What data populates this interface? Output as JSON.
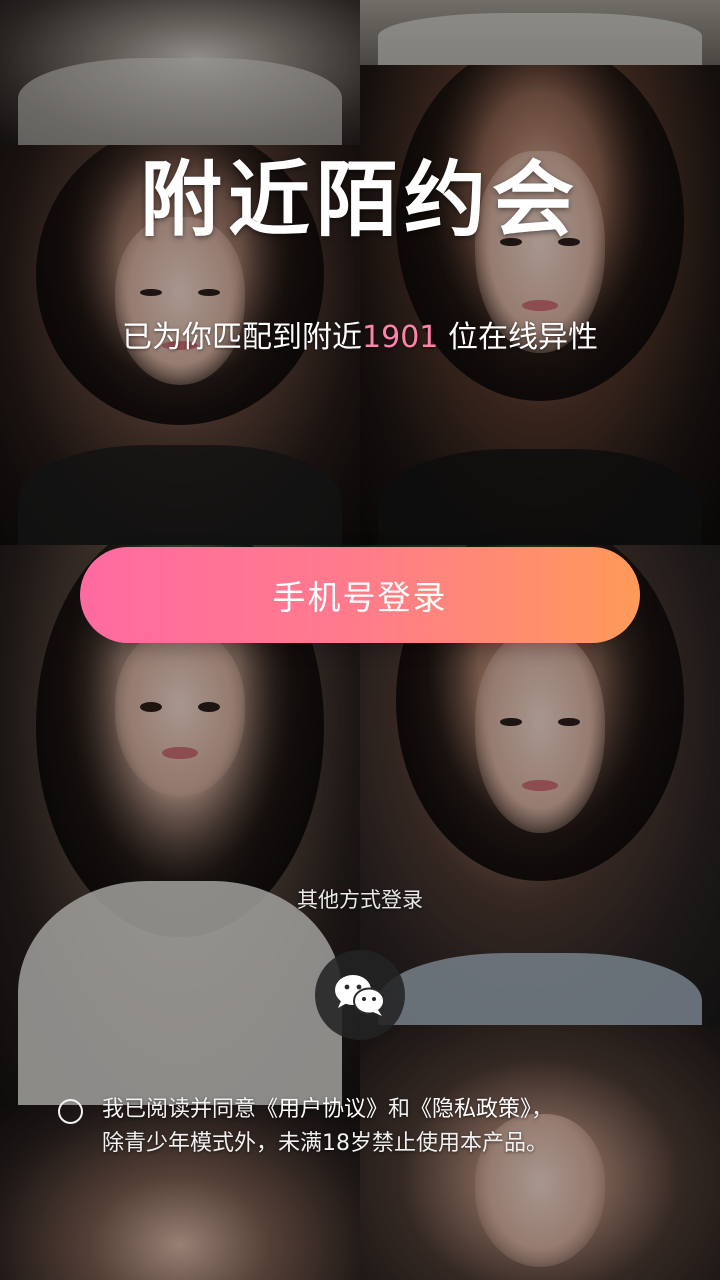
{
  "header": {
    "title": "附近陌约会",
    "subtitle_prefix": "已为你匹配到附近",
    "match_count": "1901",
    "subtitle_suffix": " 位在线异性"
  },
  "actions": {
    "phone_login_label": "手机号登录",
    "other_methods_label": "其他方式登录",
    "wechat_icon": "wechat-icon"
  },
  "agreement": {
    "text_start": "我已阅读并同意",
    "user_agreement": "《用户协议》",
    "and": "和",
    "privacy_policy": "《隐私政策》",
    "text_end": "，",
    "line2": "除青少年模式外，未满18岁禁止使用本产品。"
  },
  "colors": {
    "button_gradient_start": "#ff6aa1",
    "button_gradient_end": "#ff9a58",
    "count_highlight": "#ff83a8"
  }
}
